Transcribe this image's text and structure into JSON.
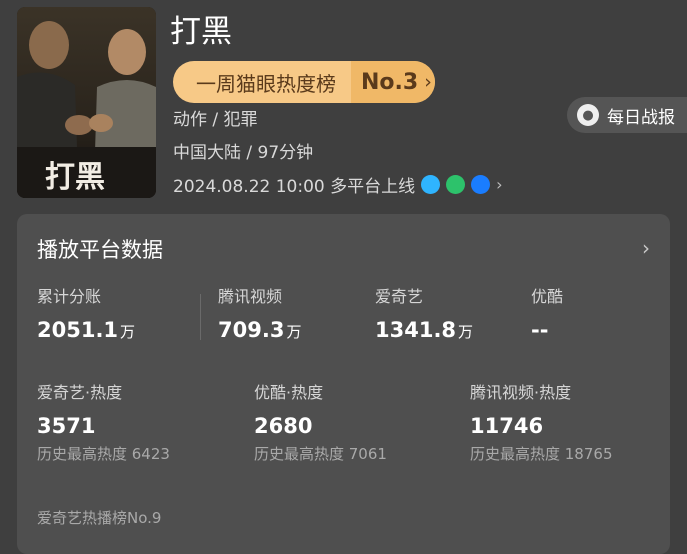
{
  "movie": {
    "title": "打黑",
    "poster_title": "打黑",
    "rank": {
      "label": "一周猫眼热度榜",
      "value": "No.3",
      "chevron": "›"
    },
    "genres": "动作 / 犯罪",
    "origin": "中国大陆 / 97分钟",
    "release": "2024.08.22 10:00 多平台上线",
    "platform_icons": [
      {
        "name": "tencent-video-icon",
        "color": "#2fb4ff"
      },
      {
        "name": "iqiyi-icon",
        "color": "#2dc26b"
      },
      {
        "name": "youku-icon",
        "color": "#1a7dff"
      }
    ],
    "release_chevron": "›"
  },
  "daily_report": {
    "label": "每日战报",
    "icon": "medal-icon"
  },
  "platform_data": {
    "title": "播放平台数据",
    "chevron": "›",
    "playback": [
      {
        "label": "累计分账",
        "value": "2051.1",
        "unit": "万"
      },
      {
        "label": "腾讯视频",
        "value": "709.3",
        "unit": "万"
      },
      {
        "label": "爱奇艺",
        "value": "1341.8",
        "unit": "万"
      },
      {
        "label": "优酷",
        "value": "--",
        "unit": ""
      }
    ],
    "heat": [
      {
        "label": "爱奇艺·热度",
        "value": "3571",
        "history": "历史最高热度 6423"
      },
      {
        "label": "优酷·热度",
        "value": "2680",
        "history": "历史最高热度 7061"
      },
      {
        "label": "腾讯视频·热度",
        "value": "11746",
        "history": "历史最高热度 18765"
      }
    ],
    "footer": "爱奇艺热播榜No.9"
  }
}
